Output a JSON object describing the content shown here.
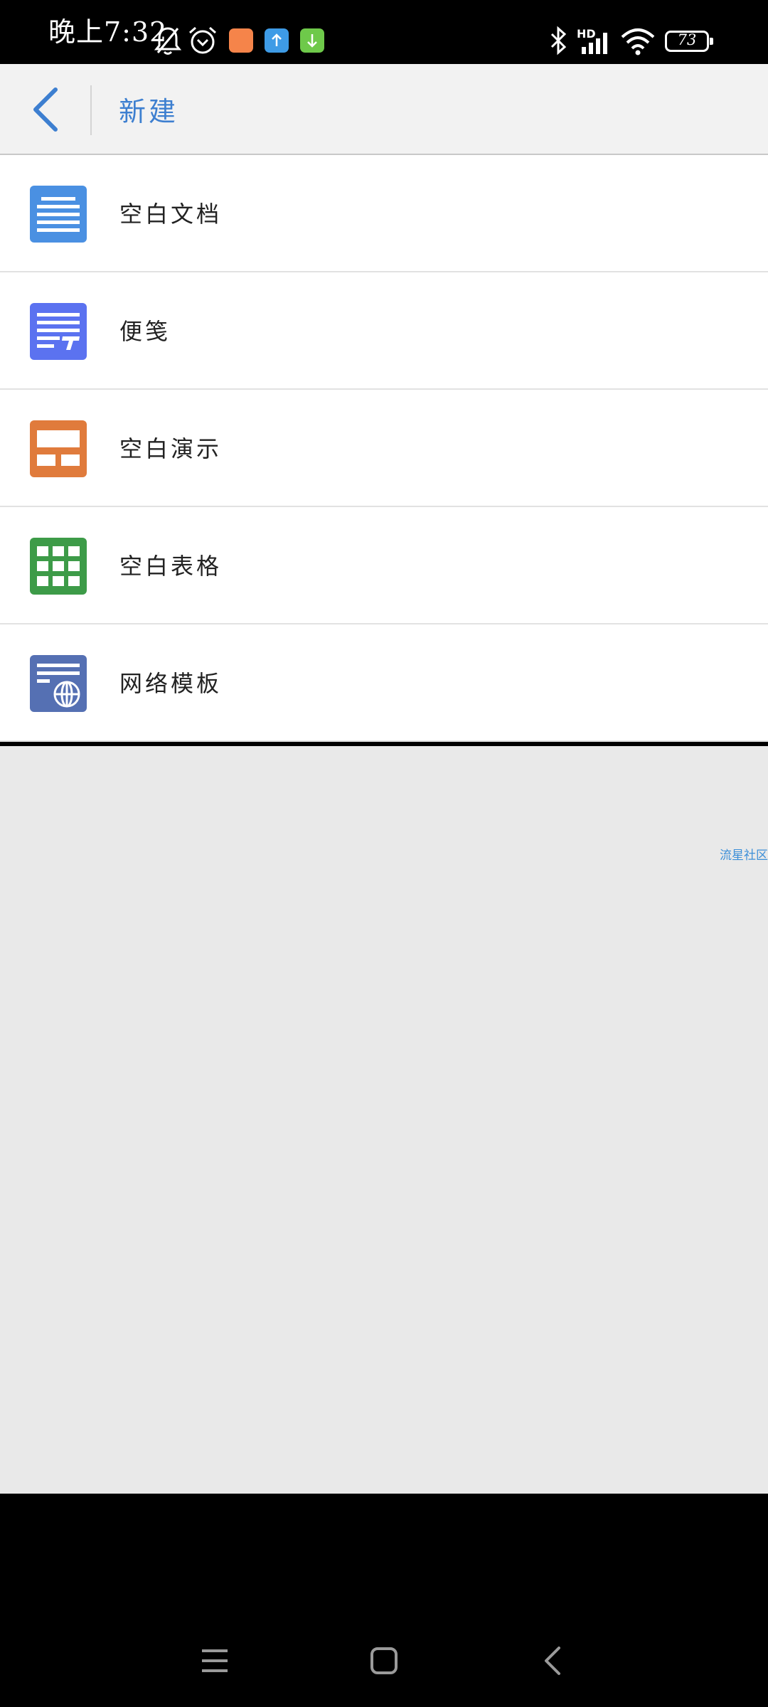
{
  "status_bar": {
    "time": "晚上7:32",
    "battery": "73",
    "network_label": "HD",
    "icons": [
      "mute-bell-icon",
      "alarm-icon",
      "app-notification-icon",
      "upload-icon",
      "download-icon",
      "bluetooth-icon",
      "signal-icon",
      "wifi-icon",
      "battery-icon"
    ],
    "app_colors": [
      "#f5844a",
      "#3e9be6",
      "#6ec94a"
    ]
  },
  "app_bar": {
    "title": "新建",
    "back_icon": "back-chevron-icon",
    "accent": "#3d7fd0"
  },
  "items": [
    {
      "label": "空白文档",
      "icon": "document-icon",
      "color": "#4a90e2"
    },
    {
      "label": "便笺",
      "icon": "note-icon",
      "color": "#5b72f0"
    },
    {
      "label": "空白演示",
      "icon": "presentation-icon",
      "color": "#e07b3c"
    },
    {
      "label": "空白表格",
      "icon": "spreadsheet-icon",
      "color": "#3d9b48"
    },
    {
      "label": "网络模板",
      "icon": "web-template-icon",
      "color": "#5570b3"
    }
  ],
  "watermark": "流星社区",
  "nav_bar": {
    "icons": [
      "menu-icon",
      "home-icon",
      "back-icon"
    ]
  }
}
